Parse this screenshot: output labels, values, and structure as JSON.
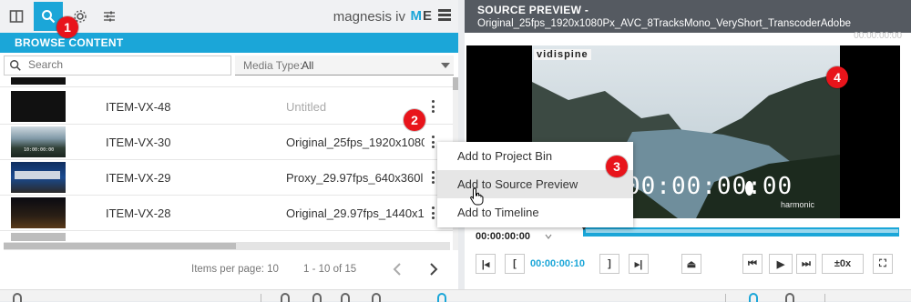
{
  "topbar": {
    "brand": "magnesis iv",
    "me_m": "M",
    "me_e": "E",
    "tabs": [
      {
        "name": "split-view",
        "icon": "columns-icon"
      },
      {
        "name": "search",
        "icon": "search-icon",
        "active": true
      },
      {
        "name": "settings",
        "icon": "gear-icon"
      },
      {
        "name": "filters",
        "icon": "sliders-icon"
      }
    ]
  },
  "browse": {
    "header": "BROWSE CONTENT",
    "search_placeholder": "Search",
    "media_type_label": "Media Type:",
    "media_type_value": "All",
    "rows": [
      {
        "id": "ITEM-VX-48",
        "title": "Untitled",
        "muted": true
      },
      {
        "id": "ITEM-VX-30",
        "title": "Original_25fps_1920x1080",
        "thumb_time": "10:00:00:00"
      },
      {
        "id": "ITEM-VX-29",
        "title": "Proxy_29.97fps_640x360l"
      },
      {
        "id": "ITEM-VX-28",
        "title": "Original_29.97fps_1440x1"
      }
    ],
    "items_per_page_label": "Items per page:",
    "items_per_page": "10",
    "range": "1 - 10 of 15"
  },
  "context_menu": {
    "items": [
      {
        "label": "Add to Project Bin"
      },
      {
        "label": "Add to Source Preview",
        "hover": true
      },
      {
        "label": "Add to Timeline"
      }
    ]
  },
  "preview": {
    "header": "SOURCE PREVIEW -",
    "filename": "Original_25fps_1920x1080Px_AVC_8TracksMono_VeryShort_TranscoderAdobe",
    "ghost_time": "00:00:00:00",
    "watermark": "vidispine",
    "overlay_timecode": "00:00:00:00",
    "harmonic": "harmonic",
    "current_time": "00:00:00:00",
    "in_time": "00:00:00:10",
    "speed": "±0x"
  },
  "annotations": [
    "1",
    "2",
    "3",
    "4"
  ],
  "colors": {
    "accent": "#1ba6d8",
    "badge": "#e8141b",
    "preview_header": "#555a61"
  }
}
